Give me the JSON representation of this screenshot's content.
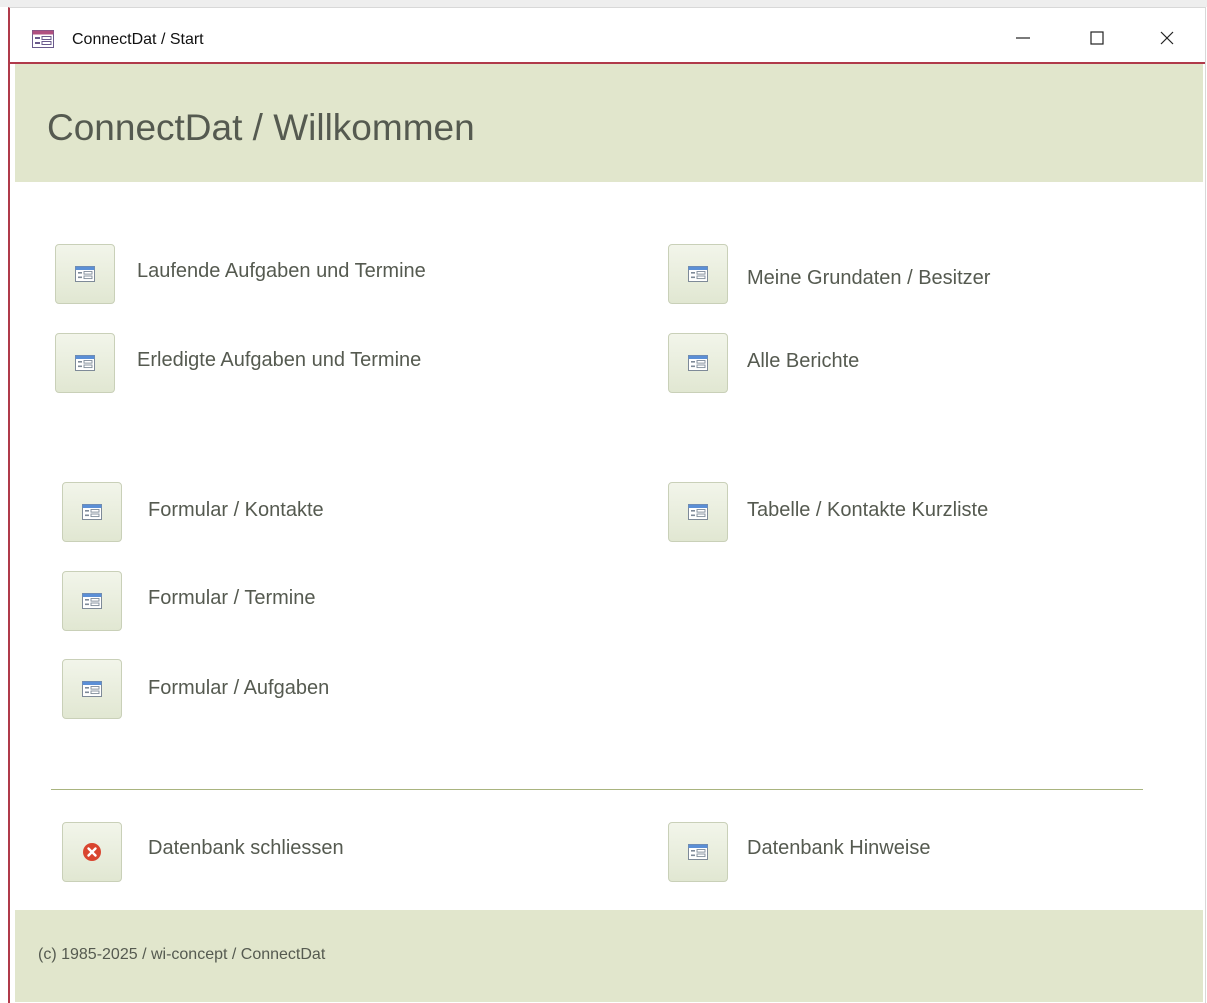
{
  "window": {
    "title": "ConnectDat / Start"
  },
  "header": {
    "title": "ConnectDat / Willkommen"
  },
  "buttons": {
    "laufende": "Laufende Aufgaben und Termine",
    "erledigte": "Erledigte Aufgaben und Termine",
    "grunddaten": "Meine Grundaten / Besitzer",
    "berichte": "Alle Berichte",
    "formular_kontakte": "Formular / Kontakte",
    "tabelle_kontakte": "Tabelle / Kontakte Kurzliste",
    "formular_termine": "Formular / Termine",
    "formular_aufgaben": "Formular / Aufgaben",
    "db_schliessen": "Datenbank schliessen",
    "db_hinweise": "Datenbank Hinweise"
  },
  "footer": {
    "copyright": "(c) 1985-2025 / wi-concept / ConnectDat"
  },
  "icons": {
    "form": "form-icon",
    "close_db": "close-circle-icon"
  },
  "colors": {
    "accent_border": "#b03a4a",
    "header_bg": "#e1e6cc",
    "text": "#555a50",
    "close_icon": "#d9452f"
  }
}
